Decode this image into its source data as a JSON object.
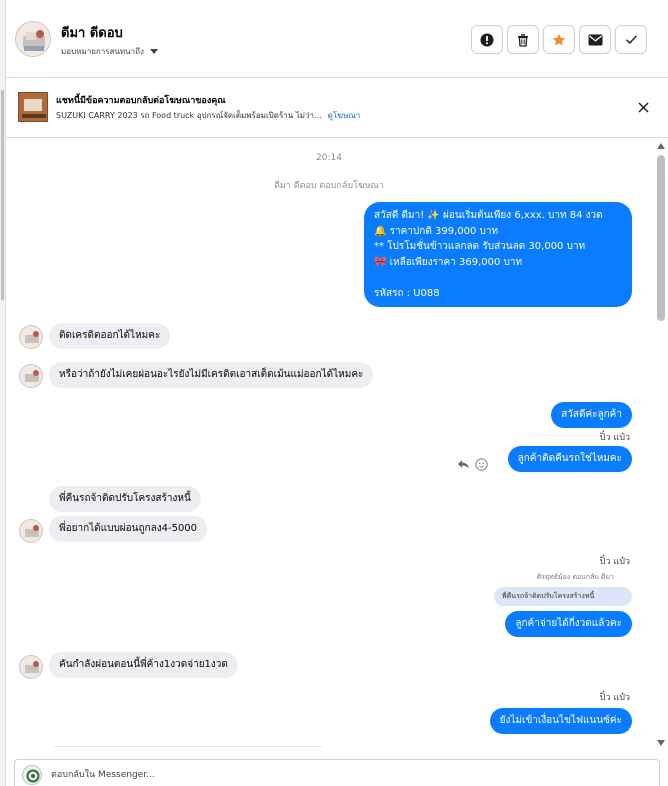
{
  "header": {
    "contact_name": "ดีมา ดีดอบ",
    "assign_label": "มอบหมายการสนทนาถึง",
    "actions": [
      {
        "name": "spam-button",
        "icon": "exclamation-circle-icon"
      },
      {
        "name": "delete-button",
        "icon": "trash-icon"
      },
      {
        "name": "star-button",
        "icon": "star-icon",
        "color": "#f5892b"
      },
      {
        "name": "mark-unread-button",
        "icon": "envelope-icon"
      },
      {
        "name": "mark-done-button",
        "icon": "checkmark-icon"
      }
    ]
  },
  "ad_banner": {
    "title": "แชทนี้มีข้อความตอบกลับต่อโฆษณาของคุณ",
    "subtitle": "SUZUKI CARRY 2023 รถ Food truck อุปกรณ์จัดเต็มพร้อมเปิดร้าน ไม่ว่า...",
    "link_label": "ดูโฆษณา"
  },
  "thread": {
    "timestamp": "20:14",
    "ad_reply_note": "ดีมา ดีดอบ ตอบกลับโฆษณา",
    "messages": {
      "m1": "สวัสดี ดีมา! ✨ ผ่อนเริ่มต้นเพียง 6,xxx. บาท 84 งวด\n🔔 ราคาปกติ 399,000 บาท\n** โปรโมชั่นข้าวแลกลด รับส่วนลด 30,000 บาท\n🎀 เหลือเพียงราคา 369,000 บาท\n\nรหัสรถ : U088",
      "m2": "ติดเครดิตออกได้ไหมคะ",
      "m3": "หรือว่าถ้ายังไม่เคยผ่อนอะไรยังไม่มีเครดิตเอาสเต็ดเม้นแม่ออกได้ไหมคะ",
      "m4": "สวัสดีค่ะลูกค้า",
      "m5": "ลูกค้าติดคืนรถใช่ไหมคะ",
      "m6": "พี่คืนรถจ้าติดปรับโครงสร้างหนี้",
      "m7": "พี่อยากได้แบบผ่อนถูกลง4-5000",
      "m8": "ลูกค้าจ่ายได้กี่งวดแล้วคะ",
      "m9": "คันกำลังผ่อนตอนนี้พี่ค้าง1งวดจ่าย1งวด",
      "m10": "ยังไม่เข้าเงื่อนไขไฟแนนซ์ค่ะ"
    },
    "sender_label_1": "ปิ๋ว แป๋ว",
    "sender_label_2": "ปิ๋ว แป๋ว",
    "sender_label_3": "ปิ๋ว แป๋ว",
    "sender_label_4": "ปิ๋ว แป๋ว",
    "reply_context": "ศิรยุทธ์ม้อง ตอบกลับ ดีมา",
    "quoted_text": "พี่คืนรถจ้าติดปรับโครงสร้างหนี้"
  },
  "composer": {
    "placeholder": "ตอบกลับใน Messenger..."
  },
  "colors": {
    "outgoing_bubble": "#0a7cff",
    "incoming_bubble": "#eceef1",
    "link": "#1663c7",
    "star": "#f5892b"
  }
}
